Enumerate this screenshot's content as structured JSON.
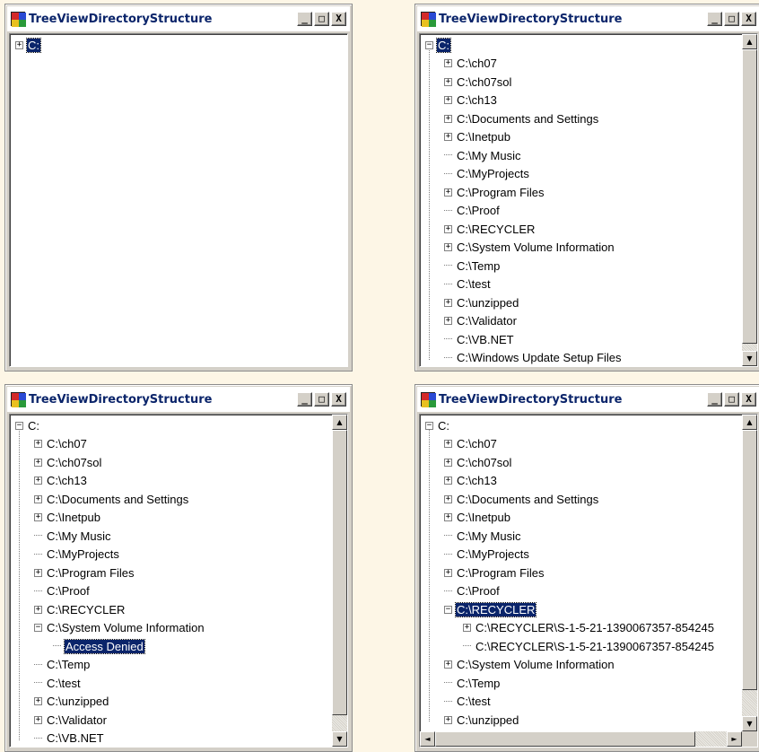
{
  "colors": {
    "selection": "#0a246a",
    "title_text": "#0a246a",
    "window_face": "#d4d0c8",
    "desktop": "#fdf6e6"
  },
  "windows": [
    {
      "title": "TreeViewDirectoryStructure",
      "controls": {
        "minimize": "_",
        "maximize": "□",
        "close": "X"
      },
      "nodes": [
        {
          "label": "C:",
          "expander": "+",
          "selected": true
        }
      ]
    },
    {
      "title": "TreeViewDirectoryStructure",
      "controls": {
        "minimize": "_",
        "maximize": "□",
        "close": "X"
      },
      "nodes": [
        {
          "label": "C:",
          "expander": "−",
          "selected": true
        },
        {
          "label": "C:\\ch07",
          "expander": "+"
        },
        {
          "label": "C:\\ch07sol",
          "expander": "+"
        },
        {
          "label": "C:\\ch13",
          "expander": "+"
        },
        {
          "label": "C:\\Documents and Settings",
          "expander": "+"
        },
        {
          "label": "C:\\Inetpub",
          "expander": "+"
        },
        {
          "label": "C:\\My Music",
          "expander": ""
        },
        {
          "label": "C:\\MyProjects",
          "expander": ""
        },
        {
          "label": "C:\\Program Files",
          "expander": "+"
        },
        {
          "label": "C:\\Proof",
          "expander": ""
        },
        {
          "label": "C:\\RECYCLER",
          "expander": "+"
        },
        {
          "label": "C:\\System Volume Information",
          "expander": "+"
        },
        {
          "label": "C:\\Temp",
          "expander": ""
        },
        {
          "label": "C:\\test",
          "expander": ""
        },
        {
          "label": "C:\\unzipped",
          "expander": "+"
        },
        {
          "label": "C:\\Validator",
          "expander": "+"
        },
        {
          "label": "C:\\VB.NET",
          "expander": ""
        },
        {
          "label": "C:\\Windows Update Setup Files",
          "expander": ""
        }
      ],
      "scrollbar": {
        "up": "▲",
        "down": "▼"
      }
    },
    {
      "title": "TreeViewDirectoryStructure",
      "controls": {
        "minimize": "_",
        "maximize": "□",
        "close": "X"
      },
      "nodes": [
        {
          "label": "C:",
          "expander": "−"
        },
        {
          "label": "C:\\ch07",
          "expander": "+"
        },
        {
          "label": "C:\\ch07sol",
          "expander": "+"
        },
        {
          "label": "C:\\ch13",
          "expander": "+"
        },
        {
          "label": "C:\\Documents and Settings",
          "expander": "+"
        },
        {
          "label": "C:\\Inetpub",
          "expander": "+"
        },
        {
          "label": "C:\\My Music",
          "expander": ""
        },
        {
          "label": "C:\\MyProjects",
          "expander": ""
        },
        {
          "label": "C:\\Program Files",
          "expander": "+"
        },
        {
          "label": "C:\\Proof",
          "expander": ""
        },
        {
          "label": "C:\\RECYCLER",
          "expander": "+"
        },
        {
          "label": "C:\\System Volume Information",
          "expander": "−"
        },
        {
          "label": "Access Denied",
          "expander": "",
          "selected": true
        },
        {
          "label": "C:\\Temp",
          "expander": ""
        },
        {
          "label": "C:\\test",
          "expander": ""
        },
        {
          "label": "C:\\unzipped",
          "expander": "+"
        },
        {
          "label": "C:\\Validator",
          "expander": "+"
        },
        {
          "label": "C:\\VB.NET",
          "expander": ""
        }
      ],
      "scrollbar": {
        "up": "▲",
        "down": "▼"
      }
    },
    {
      "title": "TreeViewDirectoryStructure",
      "controls": {
        "minimize": "_",
        "maximize": "□",
        "close": "X"
      },
      "nodes": [
        {
          "label": "C:",
          "expander": "−"
        },
        {
          "label": "C:\\ch07",
          "expander": "+"
        },
        {
          "label": "C:\\ch07sol",
          "expander": "+"
        },
        {
          "label": "C:\\ch13",
          "expander": "+"
        },
        {
          "label": "C:\\Documents and Settings",
          "expander": "+"
        },
        {
          "label": "C:\\Inetpub",
          "expander": "+"
        },
        {
          "label": "C:\\My Music",
          "expander": ""
        },
        {
          "label": "C:\\MyProjects",
          "expander": ""
        },
        {
          "label": "C:\\Program Files",
          "expander": "+"
        },
        {
          "label": "C:\\Proof",
          "expander": ""
        },
        {
          "label": "C:\\RECYCLER",
          "expander": "−",
          "selected": true
        },
        {
          "label": "C:\\RECYCLER\\S-1-5-21-1390067357-854245",
          "expander": "+"
        },
        {
          "label": "C:\\RECYCLER\\S-1-5-21-1390067357-854245",
          "expander": ""
        },
        {
          "label": "C:\\System Volume Information",
          "expander": "+"
        },
        {
          "label": "C:\\Temp",
          "expander": ""
        },
        {
          "label": "C:\\test",
          "expander": ""
        },
        {
          "label": "C:\\unzipped",
          "expander": "+"
        }
      ],
      "scrollbar": {
        "up": "▲",
        "down": "▼",
        "left": "◄",
        "right": "►"
      }
    }
  ]
}
